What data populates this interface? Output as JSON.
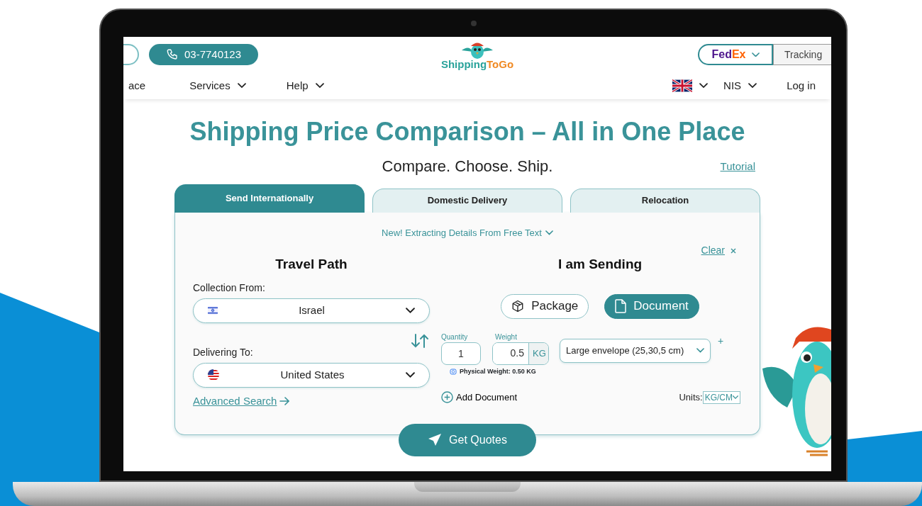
{
  "header": {
    "phone": "03-7740123",
    "logo_parts": [
      {
        "text": "Shipping",
        "color": "#2aa39b"
      },
      {
        "text": "ToGo",
        "color": "#f08a24"
      }
    ],
    "carrier_parts": [
      {
        "text": "Fed",
        "color": "#4d148c"
      },
      {
        "text": "Ex",
        "color": "#ff6200"
      }
    ],
    "tracking_placeholder": "Tracking"
  },
  "nav": {
    "items": [
      {
        "label": "ace",
        "has_menu": false
      },
      {
        "label": "Services",
        "has_menu": true
      },
      {
        "label": "Help",
        "has_menu": true
      }
    ],
    "currency": "NIS",
    "login": "Log in"
  },
  "hero": {
    "title": "Shipping Price Comparison – All in One Place",
    "subtitle": "Compare. Choose. Ship.",
    "tutorial": "Tutorial"
  },
  "tabs": [
    {
      "label": "Send Internationally",
      "selected": true
    },
    {
      "label": "Domestic Delivery",
      "selected": false
    },
    {
      "label": "Relocation",
      "selected": false
    }
  ],
  "notice": "New! Extracting Details From Free Text",
  "travel_path": {
    "heading": "Travel Path",
    "from_label": "Collection From:",
    "from": {
      "country": "Israel"
    },
    "to_label": "Delivering To:",
    "to": {
      "country": "United States"
    },
    "advanced": "Advanced Search"
  },
  "sending": {
    "heading": "I am Sending",
    "clear": "Clear",
    "types": [
      {
        "label": "Package",
        "selected": false
      },
      {
        "label": "Document",
        "selected": true
      }
    ],
    "quantity_label": "Quantity",
    "quantity": "1",
    "weight_label": "Weight",
    "weight": "0.5",
    "weight_unit": "KG",
    "envelope": "Large envelope (25,30,5 cm)",
    "add_size": "+",
    "physical_weight": "Physical Weight: 0.50 KG",
    "add": "Add Document",
    "units_label": "Units:",
    "units": "KG/CM"
  },
  "submit": "Get Quotes"
}
